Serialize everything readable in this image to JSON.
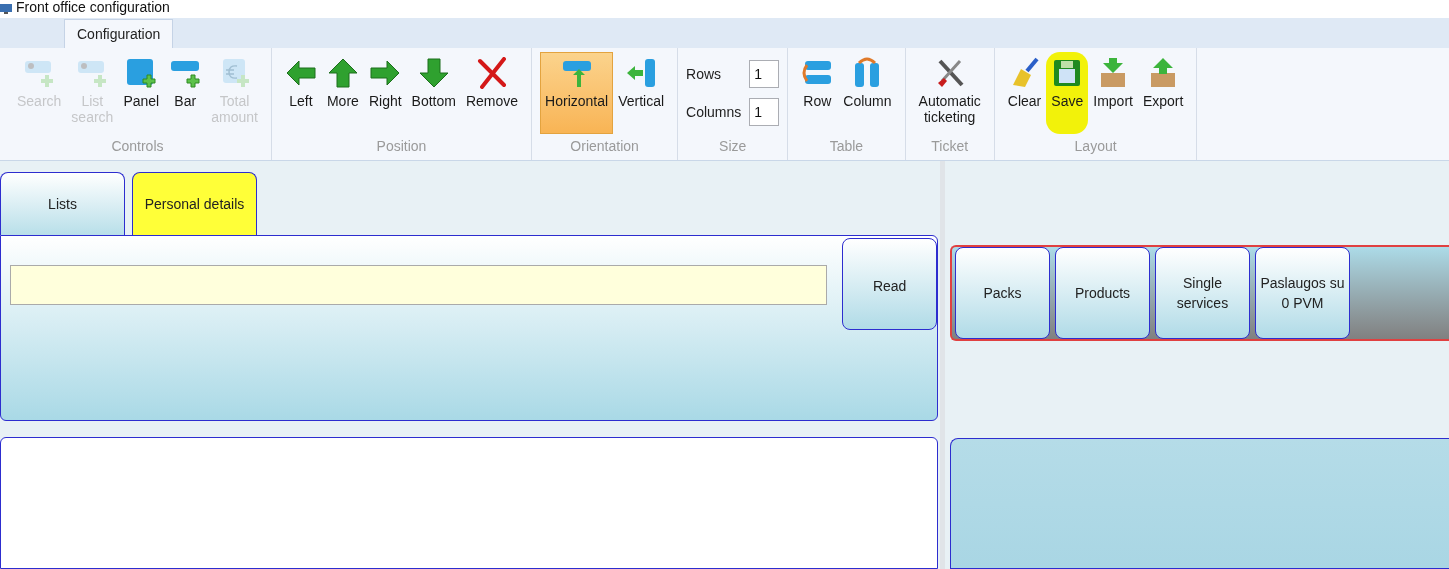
{
  "window": {
    "title": "Front office configuration"
  },
  "ribbon_tabs": [
    {
      "label": "Configuration",
      "selected": true
    }
  ],
  "ribbon_groups": [
    {
      "label": "Controls",
      "items": [
        {
          "kind": "button",
          "label": "Search",
          "disabled": true
        },
        {
          "kind": "button",
          "label": "List\nsearch",
          "disabled": true
        },
        {
          "kind": "button",
          "label": "Panel",
          "disabled": false
        },
        {
          "kind": "button",
          "label": "Bar",
          "disabled": false
        },
        {
          "kind": "button",
          "label": "Total\namount",
          "disabled": true
        }
      ]
    },
    {
      "label": "Position",
      "items": [
        {
          "kind": "button",
          "label": "Left"
        },
        {
          "kind": "button",
          "label": "More"
        },
        {
          "kind": "button",
          "label": "Right"
        },
        {
          "kind": "button",
          "label": "Bottom"
        },
        {
          "kind": "button",
          "label": "Remove"
        }
      ]
    },
    {
      "label": "Orientation",
      "items": [
        {
          "kind": "button",
          "label": "Horizontal",
          "selected": true
        },
        {
          "kind": "button",
          "label": "Vertical",
          "selected": false
        }
      ]
    },
    {
      "label": "Size",
      "items": [
        {
          "kind": "spinner",
          "label": "Rows",
          "value": "1"
        },
        {
          "kind": "spinner",
          "label": "Columns",
          "value": "1"
        }
      ]
    },
    {
      "label": "Table",
      "items": [
        {
          "kind": "button",
          "label": "Row"
        },
        {
          "kind": "button",
          "label": "Column"
        }
      ]
    },
    {
      "label": "Ticket",
      "items": [
        {
          "kind": "button",
          "label": "Automatic\nticketing"
        }
      ]
    },
    {
      "label": "Layout",
      "items": [
        {
          "kind": "button",
          "label": "Clear",
          "highlighted": false
        },
        {
          "kind": "button",
          "label": "Save",
          "highlighted": true
        },
        {
          "kind": "button",
          "label": "Import",
          "highlighted": false
        },
        {
          "kind": "button",
          "label": "Export",
          "highlighted": false
        }
      ]
    }
  ],
  "panel_tabs": [
    {
      "label": "Lists",
      "selected": false
    },
    {
      "label": "Personal details",
      "selected": true
    }
  ],
  "read_button": "Read",
  "category_buttons": [
    "Packs",
    "Products",
    "Single\nservices",
    "Paslaugos su\n0 PVM"
  ]
}
